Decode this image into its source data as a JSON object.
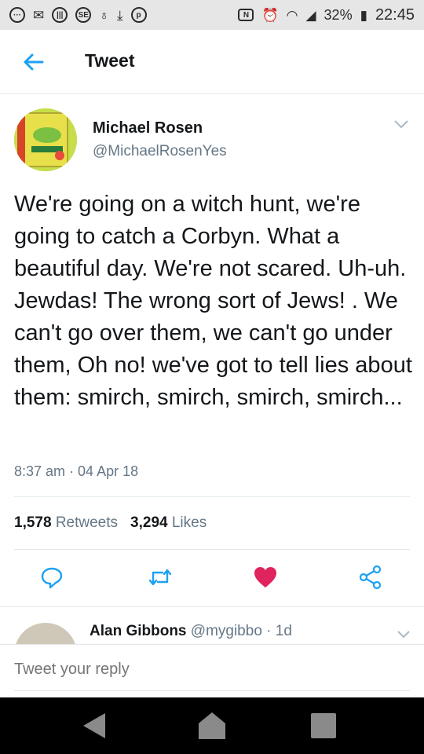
{
  "status_bar": {
    "battery": "32%",
    "time": "22:45",
    "icons": [
      "more-icon",
      "mail-icon",
      "contactless-icon",
      "se-icon",
      "bulb-icon",
      "download-icon",
      "pinterest-icon",
      "nfc-icon",
      "alarm-icon",
      "wifi-icon",
      "signal-icon",
      "battery-icon"
    ],
    "se_label": "SE",
    "nfc_label": "N"
  },
  "header": {
    "title": "Tweet"
  },
  "tweet": {
    "author_name": "Michael Rosen",
    "author_handle": "@MichaelRosenYes",
    "text": "We're going on a witch hunt, we're going to catch a Corbyn. What a beautiful day. We're not scared. Uh-uh. Jewdas! The wrong sort of Jews! . We can't go over them, we can't go under them, Oh no!  we've got to tell lies about them: smirch, smirch, smirch, smirch...",
    "timestamp": "8:37 am · 04 Apr 18",
    "retweets_count": "1,578",
    "retweets_label": "Retweets",
    "likes_count": "3,294",
    "likes_label": "Likes"
  },
  "reply_preview": {
    "name": "Alan Gibbons",
    "handle_meta": "@mygibbo · 1d"
  },
  "compose": {
    "placeholder": "Tweet your reply"
  },
  "colors": {
    "accent": "#1da1f2",
    "like": "#e0245e",
    "muted": "#657786"
  }
}
